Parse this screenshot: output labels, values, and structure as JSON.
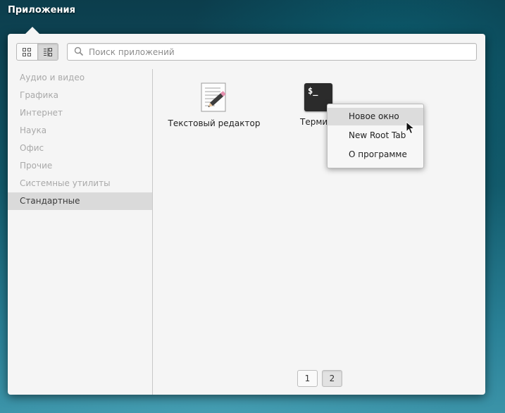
{
  "topbar": {
    "applications_label": "Приложения"
  },
  "search": {
    "placeholder": "Поиск приложений",
    "value": ""
  },
  "view_modes": {
    "selected": "category-view"
  },
  "sidebar": {
    "items": [
      {
        "label": "Аудио и видео",
        "selected": false
      },
      {
        "label": "Графика",
        "selected": false
      },
      {
        "label": "Интернет",
        "selected": false
      },
      {
        "label": "Наука",
        "selected": false
      },
      {
        "label": "Офис",
        "selected": false
      },
      {
        "label": "Прочие",
        "selected": false
      },
      {
        "label": "Системные утилиты",
        "selected": false
      },
      {
        "label": "Стандартные",
        "selected": true
      }
    ]
  },
  "apps": [
    {
      "label": "Текстовый редактор",
      "icon": "text-editor-icon"
    },
    {
      "label": "Термин",
      "icon": "terminal-icon",
      "icon_text": "$_"
    }
  ],
  "context_menu": {
    "items": [
      {
        "label": "Новое окно",
        "hovered": true
      },
      {
        "label": "New Root Tab",
        "hovered": false
      },
      {
        "label": "О программе",
        "hovered": false
      }
    ]
  },
  "pager": {
    "pages": [
      "1",
      "2"
    ],
    "current": "2"
  }
}
